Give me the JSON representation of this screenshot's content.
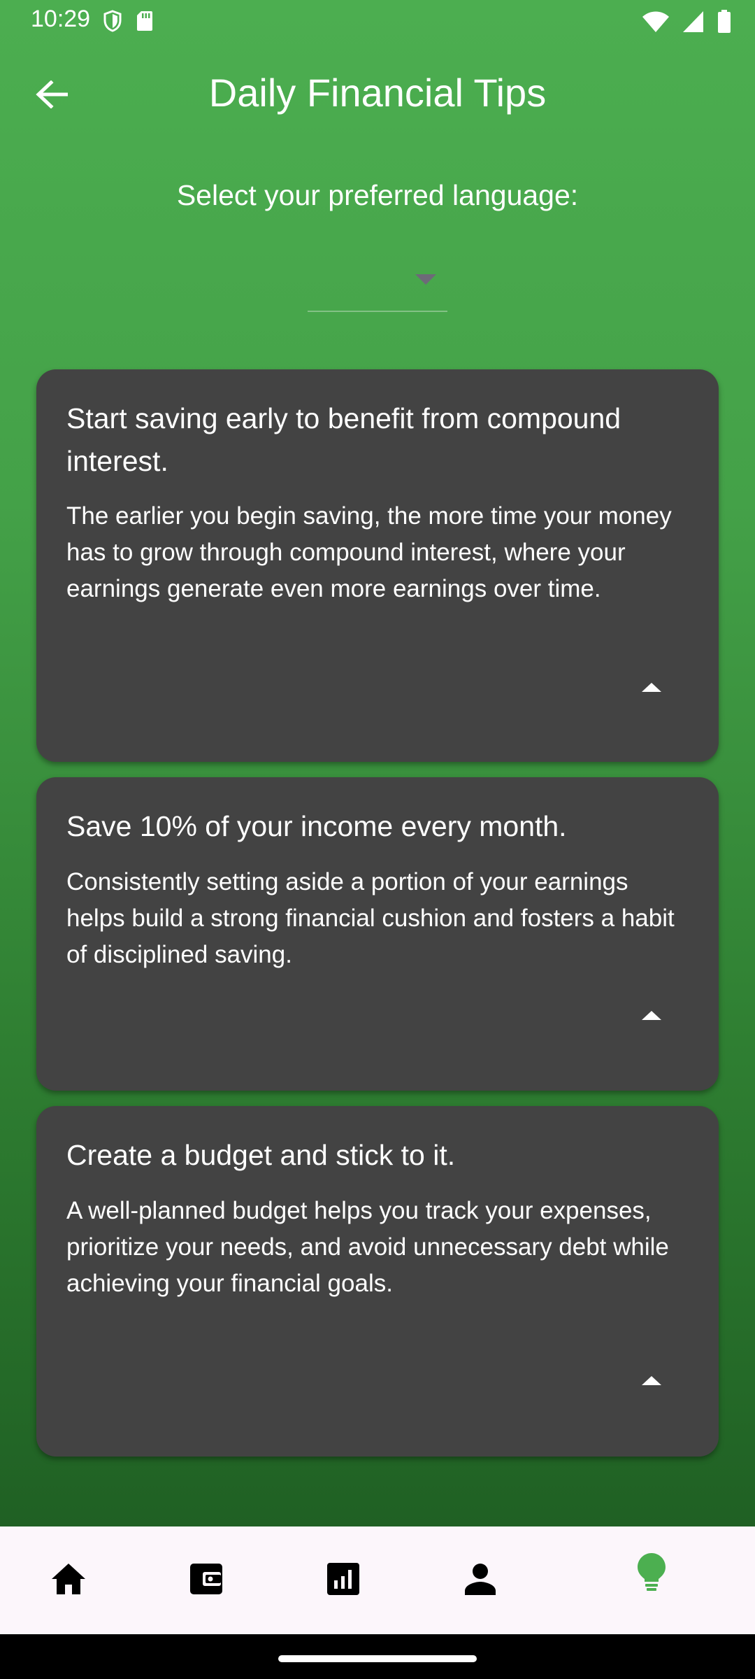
{
  "status_bar": {
    "time": "10:29",
    "left_icons": [
      "shield-icon",
      "sd-card-icon"
    ],
    "right_icons": [
      "wifi-icon",
      "signal-icon",
      "battery-icon"
    ]
  },
  "app_bar": {
    "back_icon": "arrow-back-icon",
    "title": "Daily Financial Tips"
  },
  "language": {
    "label": "Select your preferred language:",
    "selected_value": ""
  },
  "tips": [
    {
      "title": "Start saving early to benefit from compound interest.",
      "body": "The earlier you begin saving, the more time your money has to grow through compound interest, where your earnings generate even more earnings over time.",
      "toggle_icon": "arrow-drop-up-icon"
    },
    {
      "title": "Save 10% of your income every month.",
      "body": "Consistently setting aside a portion of your earnings helps build a strong financial cushion and fosters a habit of disciplined saving.",
      "toggle_icon": "arrow-drop-up-icon"
    },
    {
      "title": "Create a budget and stick to it.",
      "body": "A well-planned budget helps you track your expenses, prioritize your needs, and avoid unnecessary debt while achieving your financial goals.",
      "toggle_icon": "arrow-drop-up-icon"
    }
  ],
  "bottom_nav": {
    "items": [
      "home-icon",
      "wallet-icon",
      "chart-icon",
      "person-icon",
      "lightbulb-icon"
    ],
    "active_item": "lightbulb-icon",
    "active_color": "#4caf50",
    "inactive_color": "#000000"
  },
  "colors": {
    "gradient_top": "#4cae50",
    "gradient_bottom": "#1d5a20",
    "card": "#434343",
    "nav_background": "#fcf6fb"
  }
}
